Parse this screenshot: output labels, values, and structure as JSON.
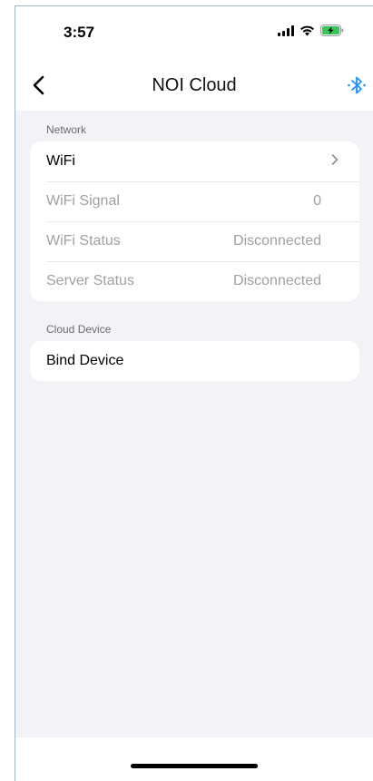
{
  "status_bar": {
    "time": "3:57",
    "signal_icon": "cellular-signal-icon",
    "wifi_icon": "wifi-icon",
    "battery_icon": "battery-charging-icon",
    "battery_color": "#34c759"
  },
  "nav": {
    "title": "NOI Cloud",
    "back_icon": "chevron-left-icon",
    "bluetooth_icon": "bluetooth-icon",
    "accent_color": "#1e90ff"
  },
  "network": {
    "header": "Network",
    "rows": [
      {
        "label": "WiFi",
        "value": "",
        "icon": "chevron-right-icon"
      },
      {
        "label": "WiFi Signal",
        "value": "0"
      },
      {
        "label": "WiFi Status",
        "value": "Disconnected"
      },
      {
        "label": "Server Status",
        "value": "Disconnected"
      }
    ]
  },
  "cloud_device": {
    "header": "Cloud Device",
    "rows": [
      {
        "label": "Bind Device"
      }
    ]
  }
}
